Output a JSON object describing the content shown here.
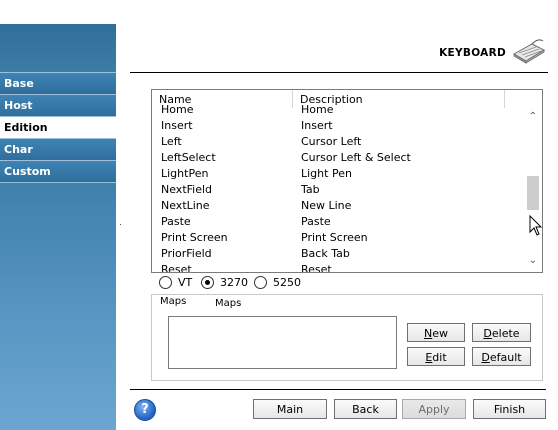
{
  "header": {
    "title": "KEYBOARD",
    "icon": "keyboard-icon"
  },
  "sidebar": {
    "items": [
      {
        "label": "Base",
        "active": false
      },
      {
        "label": "Host",
        "active": false
      },
      {
        "label": "Edition",
        "active": true
      },
      {
        "label": "Char",
        "active": false
      },
      {
        "label": "Custom",
        "active": false
      }
    ]
  },
  "keylist": {
    "columns": [
      "Name",
      "Description"
    ],
    "rows": [
      {
        "name": "Home",
        "desc": "Home"
      },
      {
        "name": "Insert",
        "desc": "Insert"
      },
      {
        "name": "Left",
        "desc": "Cursor Left"
      },
      {
        "name": "LeftSelect",
        "desc": "Cursor Left & Select"
      },
      {
        "name": "LightPen",
        "desc": "Light Pen"
      },
      {
        "name": "NextField",
        "desc": "Tab"
      },
      {
        "name": "NextLine",
        "desc": "New Line"
      },
      {
        "name": "Paste",
        "desc": "Paste"
      },
      {
        "name": "Print Screen",
        "desc": "Print Screen"
      },
      {
        "name": "PriorField",
        "desc": "Back Tab"
      },
      {
        "name": "Reset",
        "desc": "Reset"
      }
    ]
  },
  "terminal_type": {
    "options": [
      {
        "label": "VT",
        "selected": false
      },
      {
        "label": "3270",
        "selected": true
      },
      {
        "label": "5250",
        "selected": false
      }
    ]
  },
  "maps": {
    "group_legend": "Maps",
    "list_label": "Maps",
    "buttons": {
      "new": {
        "mnemonic": "N",
        "rest": "ew"
      },
      "delete": {
        "mnemonic": "D",
        "rest": "elete"
      },
      "edit": {
        "mnemonic": "E",
        "rest": "dit"
      },
      "default": {
        "mnemonic": "D",
        "rest": "efault"
      }
    }
  },
  "footer": {
    "help_symbol": "?",
    "main": "Main",
    "back": "Back",
    "apply": "Apply",
    "finish": "Finish"
  }
}
